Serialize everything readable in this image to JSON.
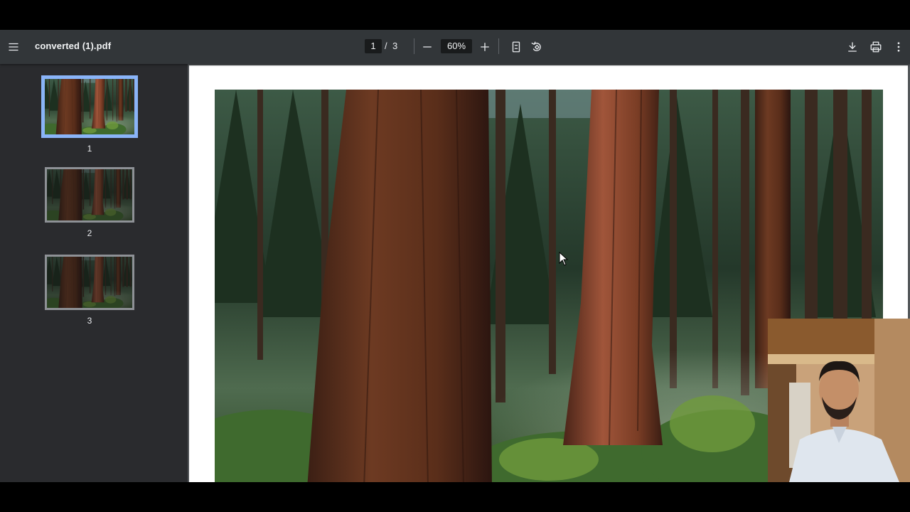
{
  "toolbar": {
    "menu_icon": "menu-icon",
    "file_name": "converted (1).pdf",
    "current_page": "1",
    "page_separator": "/",
    "total_pages": "3",
    "zoom_out_icon": "minus-icon",
    "zoom_level": "60%",
    "zoom_in_icon": "plus-icon",
    "fit_page_icon": "fit-to-page-icon",
    "rotate_icon": "rotate-counterclockwise-icon",
    "download_icon": "download-icon",
    "print_icon": "print-icon",
    "more_icon": "more-vert-icon"
  },
  "sidebar": {
    "thumbnails": [
      {
        "label": "1",
        "selected": true
      },
      {
        "label": "2",
        "selected": false
      },
      {
        "label": "3",
        "selected": false
      }
    ]
  },
  "viewer": {
    "page_content": "forest-photo"
  },
  "colors": {
    "toolbar_bg": "#323639",
    "sidebar_bg": "#2a2b2e",
    "viewer_bg": "#525659",
    "thumb_selected_border": "#8ab4f8"
  }
}
